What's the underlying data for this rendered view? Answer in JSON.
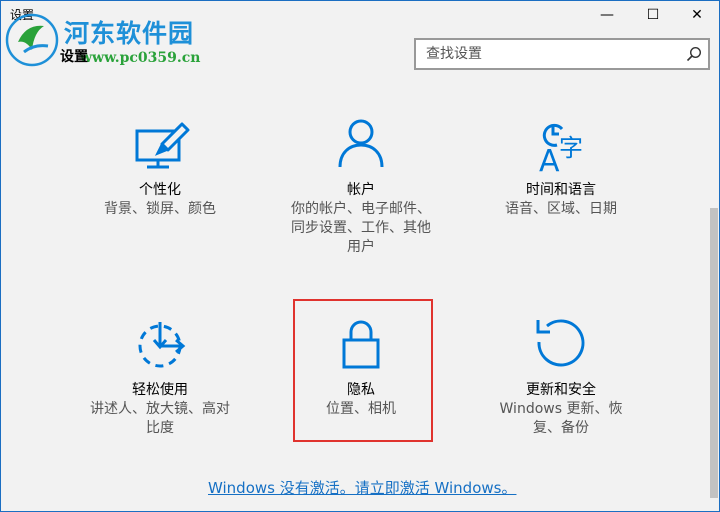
{
  "window": {
    "title": "设置",
    "minimize_glyph": "—",
    "maximize_glyph": "☐",
    "close_glyph": "✕"
  },
  "watermark": {
    "name": "河东软件园",
    "url": "www.pc0359.cn"
  },
  "page": {
    "title": "设置"
  },
  "search": {
    "placeholder": "查找设置"
  },
  "tiles": [
    {
      "title": "个性化",
      "desc": "背景、锁屏、颜色",
      "icon": "personalization-icon"
    },
    {
      "title": "帐户",
      "desc": "你的帐户、电子邮件、同步设置、工作、其他用户",
      "icon": "account-icon"
    },
    {
      "title": "时间和语言",
      "desc": "语音、区域、日期",
      "icon": "time-language-icon"
    },
    {
      "title": "轻松使用",
      "desc": "讲述人、放大镜、高对比度",
      "icon": "ease-of-access-icon"
    },
    {
      "title": "隐私",
      "desc": "位置、相机",
      "icon": "privacy-lock-icon"
    },
    {
      "title": "更新和安全",
      "desc": "Windows 更新、恢复、备份",
      "icon": "update-refresh-icon"
    }
  ],
  "activation": {
    "link_text": "Windows 没有激活。请立即激活 Windows。"
  },
  "colors": {
    "accent": "#0078d7",
    "highlight": "#e0332e",
    "link": "#1670c4"
  }
}
